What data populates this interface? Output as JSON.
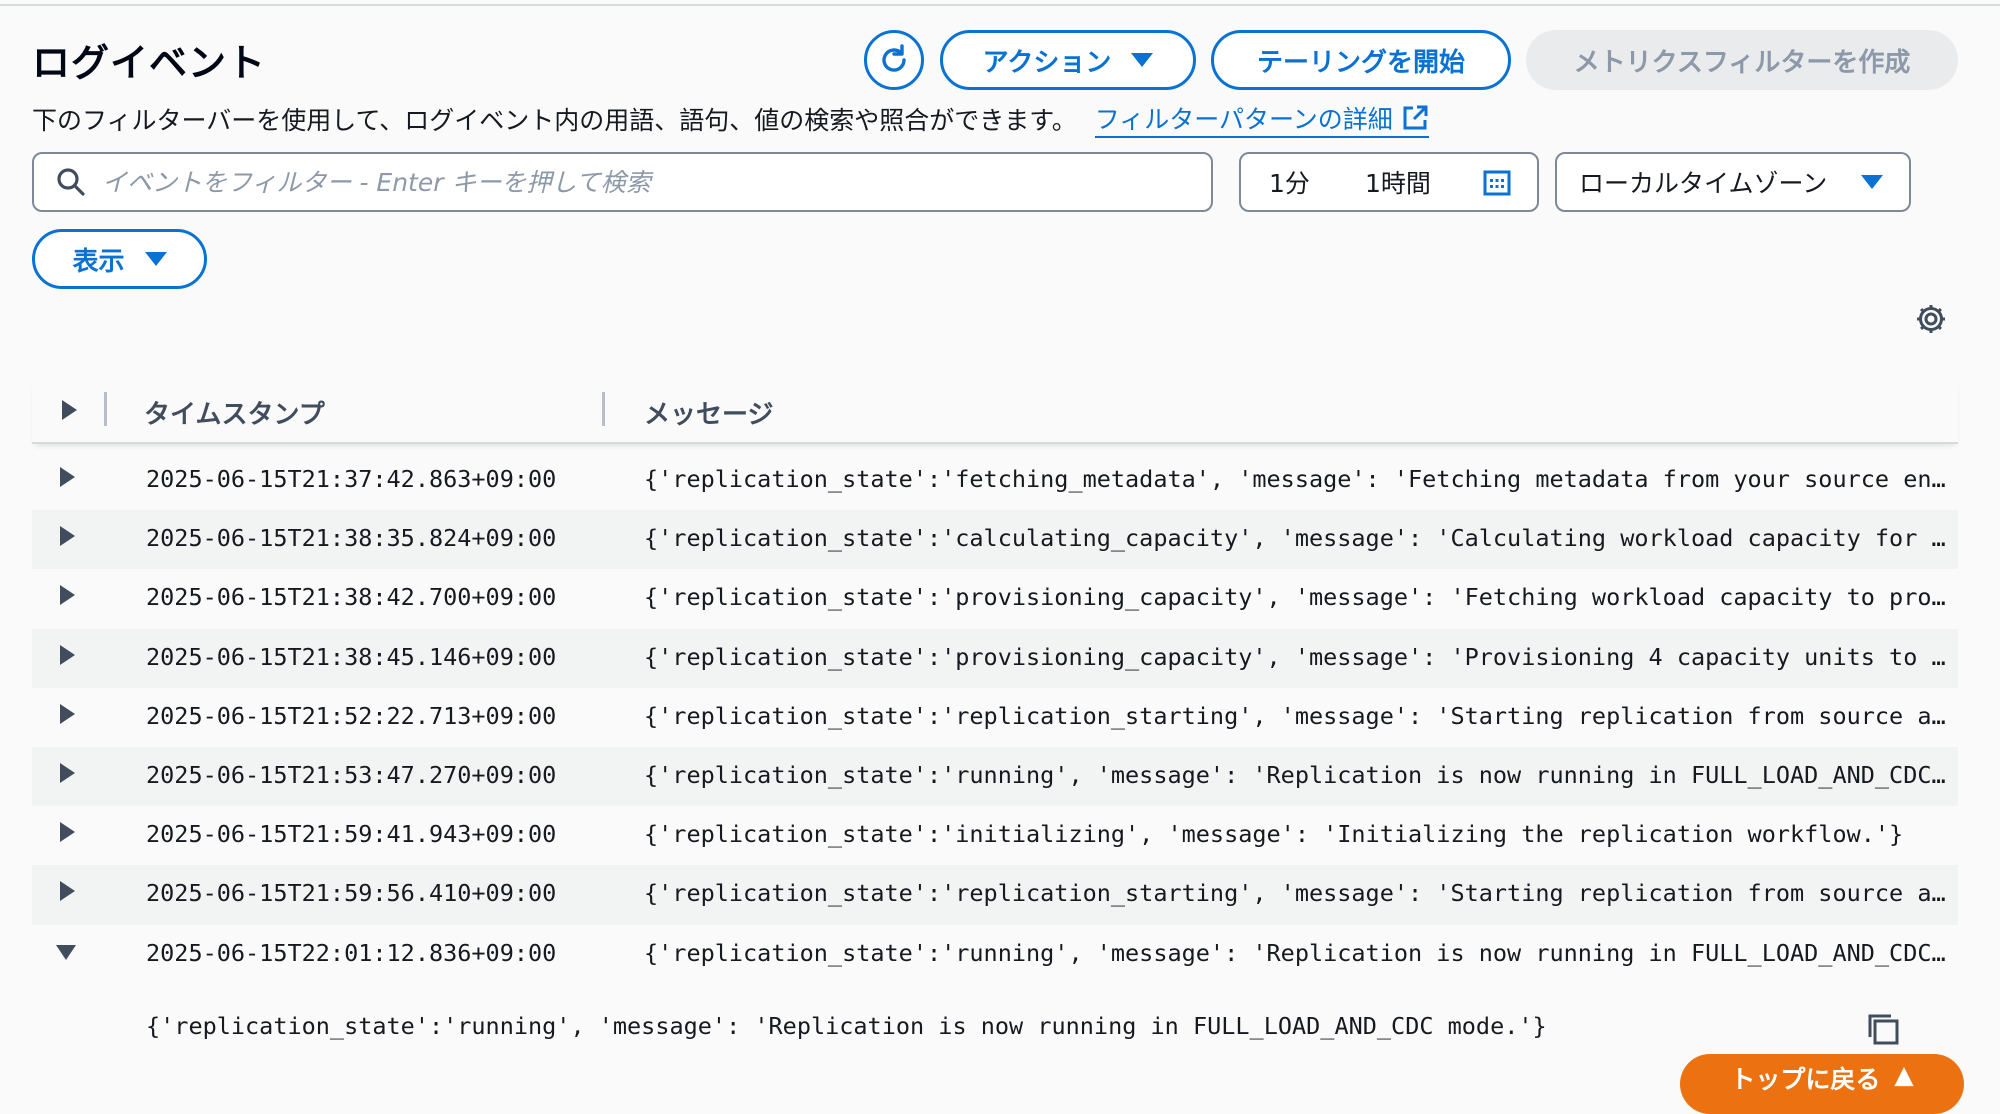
{
  "header": {
    "title": "ログイベント",
    "refresh_icon": "refresh-icon",
    "actions_label": "アクション",
    "tail_label": "テーリングを開始",
    "create_metric_filter_label": "メトリクスフィルターを作成"
  },
  "description": {
    "text": "下のフィルターバーを使用して、ログイベント内の用語、語句、値の検索や照合ができます。",
    "link_label": "フィルターパターンの詳細",
    "link_icon": "external-link-icon"
  },
  "filter": {
    "placeholder": "イベントをフィルター - Enter キーを押して検索",
    "value": ""
  },
  "time_range": {
    "option_1": "1分",
    "option_2": "1時間",
    "calendar_icon": "calendar-icon"
  },
  "timezone": {
    "selected": "ローカルタイムゾーン"
  },
  "display_button": {
    "label": "表示"
  },
  "table": {
    "columns": {
      "timestamp": "タイムスタンプ",
      "message": "メッセージ"
    },
    "rows": [
      {
        "timestamp": "2025-06-15T21:37:42.863+09:00",
        "message": "{'replication_state':'fetching_metadata', 'message': 'Fetching metadata from your source en…"
      },
      {
        "timestamp": "2025-06-15T21:38:35.824+09:00",
        "message": "{'replication_state':'calculating_capacity', 'message': 'Calculating workload capacity for …"
      },
      {
        "timestamp": "2025-06-15T21:38:42.700+09:00",
        "message": "{'replication_state':'provisioning_capacity', 'message': 'Fetching workload capacity to pro…"
      },
      {
        "timestamp": "2025-06-15T21:38:45.146+09:00",
        "message": "{'replication_state':'provisioning_capacity', 'message': 'Provisioning 4 capacity units to …"
      },
      {
        "timestamp": "2025-06-15T21:52:22.713+09:00",
        "message": "{'replication_state':'replication_starting', 'message': 'Starting replication from source a…"
      },
      {
        "timestamp": "2025-06-15T21:53:47.270+09:00",
        "message": "{'replication_state':'running', 'message': 'Replication is now running in FULL_LOAD_AND_CDC…"
      },
      {
        "timestamp": "2025-06-15T21:59:41.943+09:00",
        "message": "{'replication_state':'initializing', 'message': 'Initializing the replication workflow.'}"
      },
      {
        "timestamp": "2025-06-15T21:59:56.410+09:00",
        "message": "{'replication_state':'replication_starting', 'message': 'Starting replication from source a…"
      },
      {
        "timestamp": "2025-06-15T22:01:12.836+09:00",
        "message": "{'replication_state':'running', 'message': 'Replication is now running in FULL_LOAD_AND_CDC…",
        "expanded": true
      }
    ],
    "expanded_detail": "{'replication_state':'running', 'message': 'Replication is now running in FULL_LOAD_AND_CDC mode.'}"
  },
  "back_to_top": {
    "label": "トップに戻る"
  },
  "colors": {
    "accent": "#0972d3",
    "back_to_top": "#ec7211",
    "disabled": "#e9ebed"
  }
}
